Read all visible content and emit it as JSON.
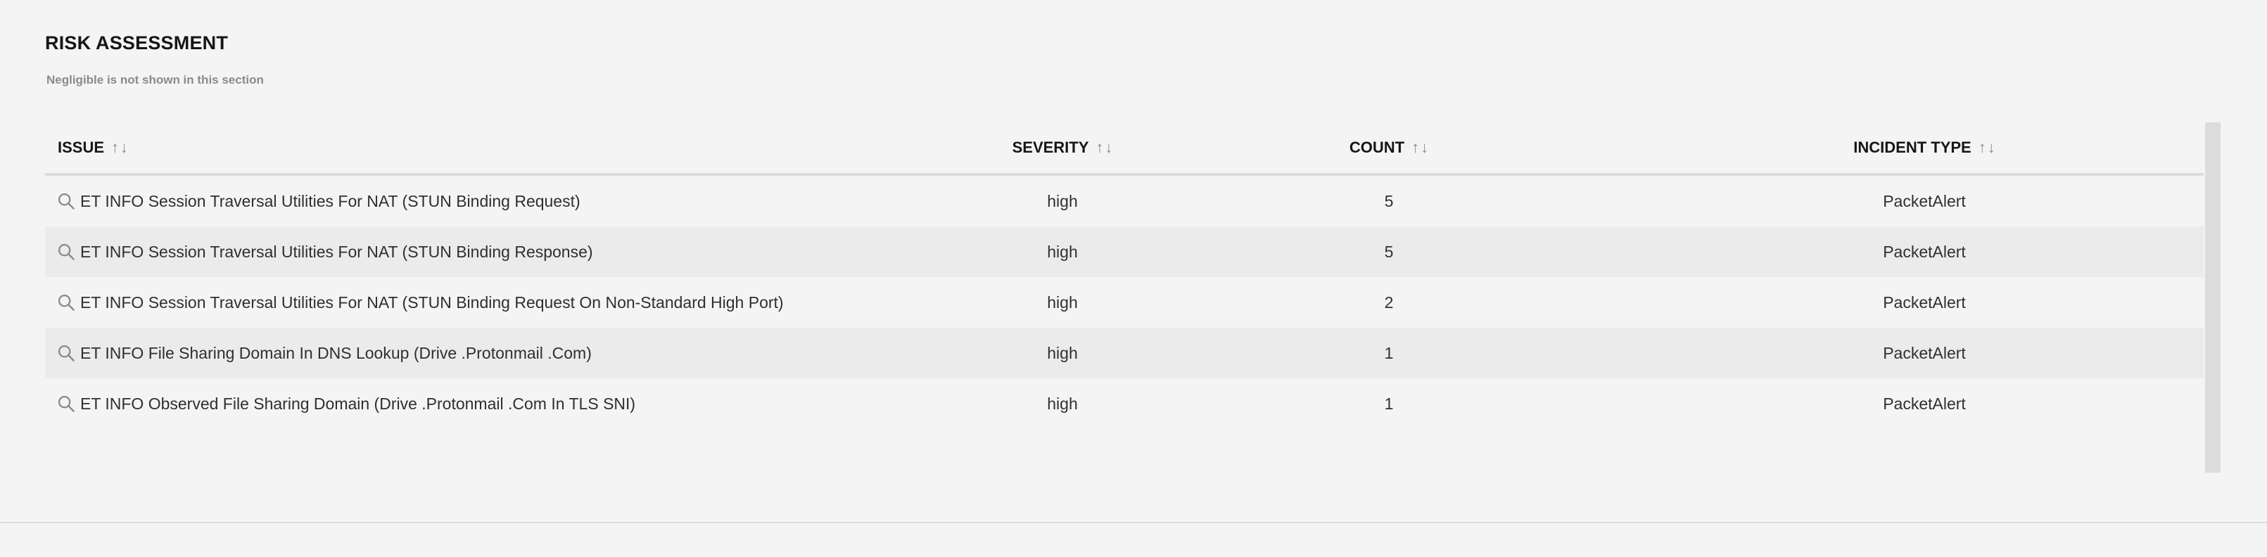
{
  "section": {
    "title": "RISK ASSESSMENT",
    "subtitle": "Negligible is not shown in this section"
  },
  "table": {
    "columns": [
      {
        "label": "ISSUE"
      },
      {
        "label": "SEVERITY"
      },
      {
        "label": "COUNT"
      },
      {
        "label": "INCIDENT TYPE"
      }
    ],
    "sort_up_glyph": "↑",
    "sort_down_glyph": "↓",
    "rows": [
      {
        "issue": "ET INFO Session Traversal Utilities For NAT (STUN Binding Request)",
        "severity": "high",
        "count": "5",
        "incident_type": "PacketAlert"
      },
      {
        "issue": "ET INFO Session Traversal Utilities For NAT (STUN Binding Response)",
        "severity": "high",
        "count": "5",
        "incident_type": "PacketAlert"
      },
      {
        "issue": "ET INFO Session Traversal Utilities For NAT (STUN Binding Request On Non-Standard High Port)",
        "severity": "high",
        "count": "2",
        "incident_type": "PacketAlert"
      },
      {
        "issue": "ET INFO File Sharing Domain In DNS Lookup (Drive .Protonmail .Com)",
        "severity": "high",
        "count": "1",
        "incident_type": "PacketAlert"
      },
      {
        "issue": "ET INFO Observed File Sharing Domain (Drive .Protonmail .Com In TLS SNI)",
        "severity": "high",
        "count": "1",
        "incident_type": "PacketAlert"
      }
    ]
  },
  "icons": {
    "row_icon": "search-icon",
    "sort_icon": "sort-arrows-icon"
  },
  "colors": {
    "background": "#f4f4f4",
    "alt_row": "#ebebeb",
    "header_text": "#161616",
    "muted_text": "#8a8a8a",
    "divider": "#dcdcdc"
  }
}
